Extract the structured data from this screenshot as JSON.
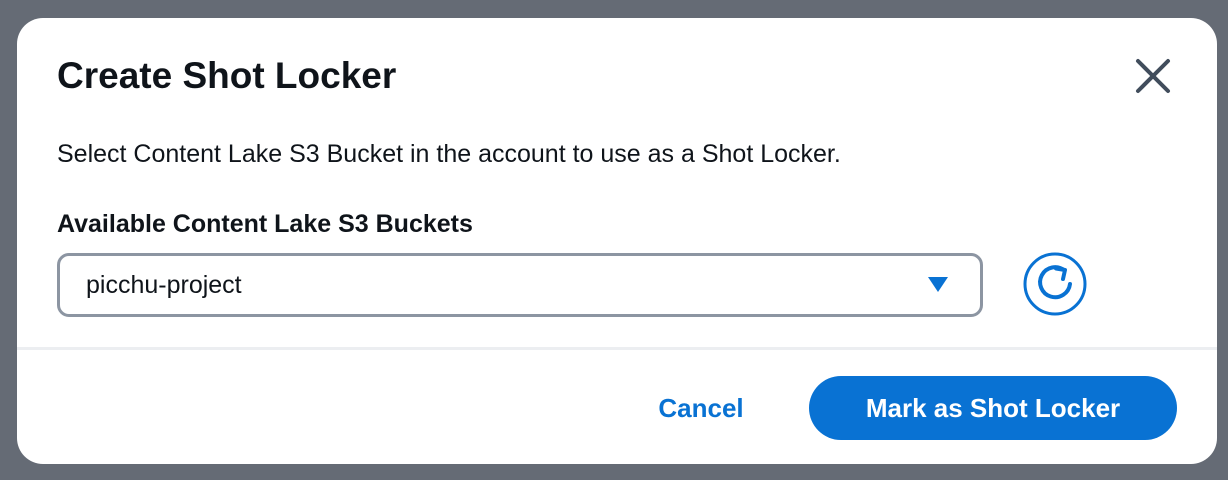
{
  "dialog": {
    "title": "Create Shot Locker",
    "description": "Select Content Lake S3 Bucket in the account to use as a Shot Locker.",
    "field_label": "Available Content Lake S3 Buckets",
    "selected_bucket": "picchu-project"
  },
  "footer": {
    "cancel_label": "Cancel",
    "primary_label": "Mark as Shot Locker"
  },
  "icons": {
    "close": "close-icon",
    "dropdown": "caret-down-icon",
    "refresh": "refresh-icon"
  },
  "colors": {
    "backdrop": "#656b75",
    "accent": "#0972d3",
    "text": "#0f141a",
    "border": "#8c95a2"
  }
}
